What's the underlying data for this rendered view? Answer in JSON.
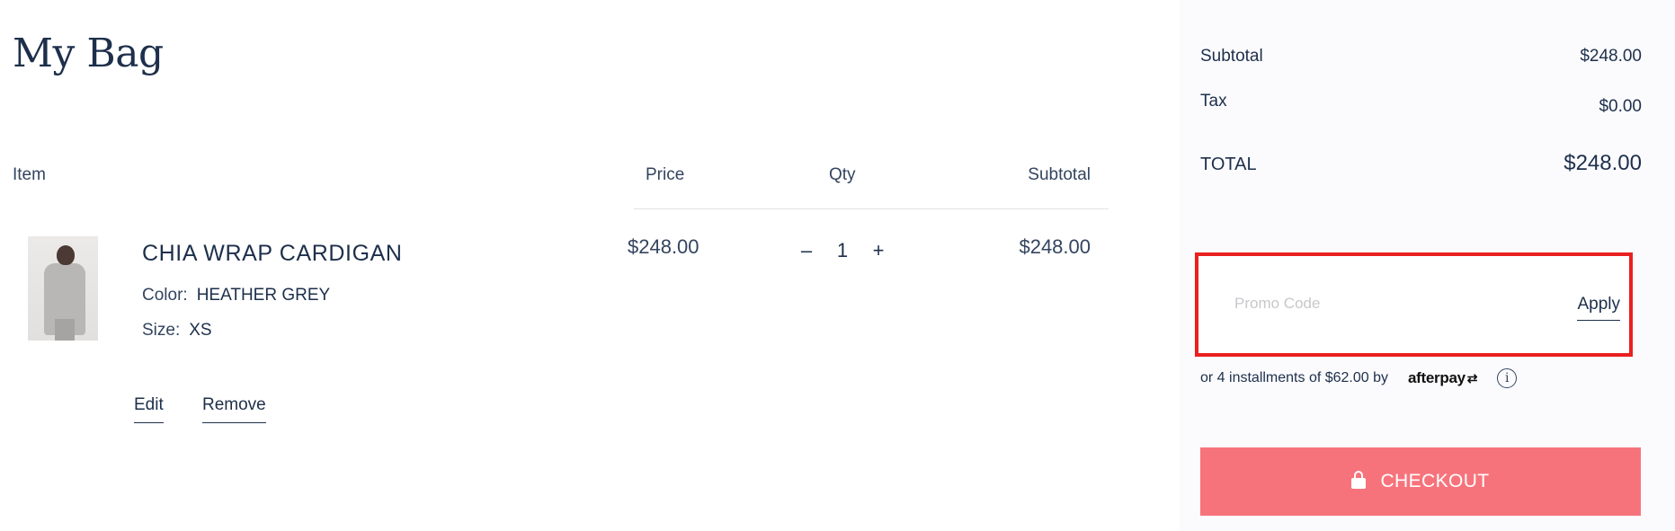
{
  "bag": {
    "title": "My Bag",
    "columns": {
      "item": "Item",
      "price": "Price",
      "qty": "Qty",
      "subtotal": "Subtotal"
    },
    "items": [
      {
        "name": "CHIA WRAP CARDIGAN",
        "color_label": "Color:",
        "color_value": "HEATHER GREY",
        "size_label": "Size:",
        "size_value": "XS",
        "price": "$248.00",
        "qty": "1",
        "qty_minus": "–",
        "qty_plus": "+",
        "subtotal": "$248.00",
        "edit_label": "Edit",
        "remove_label": "Remove"
      }
    ]
  },
  "summary": {
    "subtotal_label": "Subtotal",
    "subtotal_value": "$248.00",
    "tax_label": "Tax",
    "tax_value": "$0.00",
    "total_label": "TOTAL",
    "total_value": "$248.00",
    "promo": {
      "placeholder": "Promo Code",
      "value": "",
      "apply_label": "Apply"
    },
    "afterpay": {
      "text": "or 4 installments of $62.00 by",
      "logo_text": "afterpay",
      "logo_arrows": "⇄",
      "info_glyph": "i"
    },
    "checkout_label": "CHECKOUT"
  },
  "colors": {
    "navy_text": "#1d2f4b",
    "checkout_bg": "#f7737c",
    "highlight_border": "#ea1f1f",
    "summary_bg": "#fbfbfd"
  },
  "icons": [
    "lock-icon",
    "info-icon",
    "afterpay-logo"
  ]
}
